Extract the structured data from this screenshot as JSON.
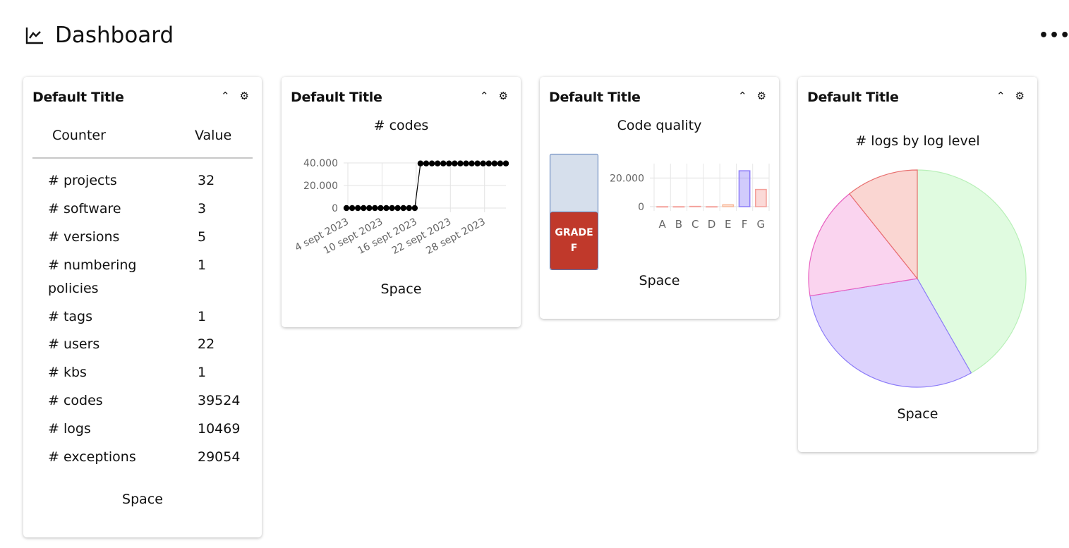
{
  "header": {
    "title": "Dashboard",
    "icon": "line-chart-icon",
    "more_label": "•••"
  },
  "cards": [
    {
      "title": "Default Title",
      "caption": "Space",
      "table": {
        "headers": [
          "Counter",
          "Value"
        ],
        "rows": [
          [
            "# projects",
            "32"
          ],
          [
            "# software",
            "3"
          ],
          [
            "# versions",
            "5"
          ],
          [
            "# numbering policies",
            "1"
          ],
          [
            "# tags",
            "1"
          ],
          [
            "# users",
            "22"
          ],
          [
            "# kbs",
            "1"
          ],
          [
            "# codes",
            "39524"
          ],
          [
            "# logs",
            "10469"
          ],
          [
            "# exceptions",
            "29054"
          ]
        ]
      }
    },
    {
      "title": "Default Title",
      "caption": "Space"
    },
    {
      "title": "Default Title",
      "caption": "Space",
      "grade_label": "GRADE",
      "grade": "F",
      "grade_color": "#c0392b"
    },
    {
      "title": "Default Title",
      "caption": "Space"
    }
  ],
  "chart_data": [
    {
      "type": "line",
      "title": "# codes",
      "x": [
        "2023-09-04",
        "2023-09-05",
        "2023-09-06",
        "2023-09-07",
        "2023-09-08",
        "2023-09-09",
        "2023-09-10",
        "2023-09-11",
        "2023-09-12",
        "2023-09-13",
        "2023-09-14",
        "2023-09-15",
        "2023-09-16",
        "2023-09-17",
        "2023-09-18",
        "2023-09-19",
        "2023-09-20",
        "2023-09-21",
        "2023-09-22",
        "2023-09-23",
        "2023-09-24",
        "2023-09-25",
        "2023-09-26",
        "2023-09-27",
        "2023-09-28",
        "2023-09-29",
        "2023-09-30",
        "2023-10-01",
        "2023-10-02"
      ],
      "y": [
        0,
        0,
        0,
        0,
        0,
        0,
        0,
        0,
        0,
        0,
        0,
        0,
        0,
        39524,
        39524,
        39524,
        39524,
        39524,
        39524,
        39524,
        39524,
        39524,
        39524,
        39524,
        39524,
        39524,
        39524,
        39524,
        39524
      ],
      "xtick_labels": [
        "4 sept 2023",
        "10 sept 2023",
        "16 sept 2023",
        "22 sept 2023",
        "28 sept 2023"
      ],
      "ytick_labels": [
        "0",
        "20.000",
        "40.000"
      ],
      "yticks": [
        0,
        20000,
        40000
      ],
      "ylim": [
        0,
        40000
      ],
      "grid": true,
      "color": "#000000"
    },
    {
      "type": "bar",
      "title": "Code quality",
      "categories": [
        "A",
        "B",
        "C",
        "D",
        "E",
        "F",
        "G"
      ],
      "values": [
        0,
        0,
        200,
        0,
        1300,
        25000,
        12000
      ],
      "colors": [
        "#f4a09a",
        "#f4a09a",
        "#f4a09a",
        "#f4a09a",
        "#f8b99a",
        "#8c7cf8",
        "#f4a09a"
      ],
      "ytick_labels": [
        "0",
        "20.000"
      ],
      "yticks": [
        0,
        20000
      ],
      "ylim": [
        0,
        30000
      ],
      "grid": true
    },
    {
      "type": "pie",
      "title": "# logs by log level",
      "values": [
        4370,
        3215,
        1760,
        1124
      ],
      "colors": [
        "#e0fbe0",
        "#dcd2fd",
        "#fad4ef",
        "#fad6d2"
      ],
      "borders": [
        "#b8f0b8",
        "#8c7cf8",
        "#e85fc0",
        "#e87070"
      ]
    }
  ]
}
